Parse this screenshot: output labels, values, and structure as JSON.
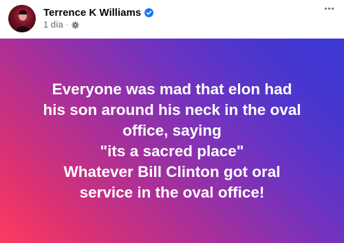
{
  "post": {
    "author": "Terrence K Williams",
    "timestamp": "1 día",
    "separator": "·",
    "privacy_icon": "gear-icon",
    "verified_icon": "verified-badge-icon",
    "more_icon": "more-options-icon",
    "text_lines": [
      "Everyone was mad that elon had",
      "his son around his neck in the oval",
      "office, saying",
      "\"its a sacred place\"",
      "Whatever Bill Clinton got oral",
      "service in the oval office!"
    ]
  },
  "colors": {
    "verified_blue": "#1877f2",
    "gradient_start": "#ff3a5e",
    "gradient_end": "#3b38d4",
    "meta_gray": "#65676b"
  }
}
